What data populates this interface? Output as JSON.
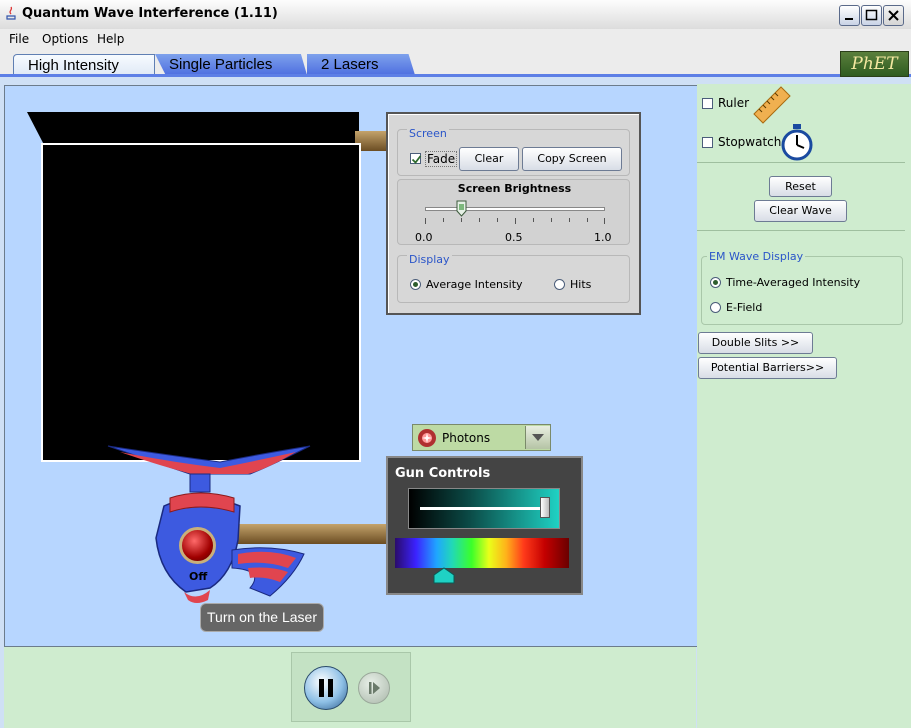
{
  "window": {
    "title": "Quantum Wave Interference (1.11)"
  },
  "menu": [
    "File",
    "Options",
    "Help"
  ],
  "tabs": [
    {
      "label": "High Intensity",
      "active": true
    },
    {
      "label": "Single Particles",
      "active": false
    },
    {
      "label": "2 Lasers",
      "active": false
    }
  ],
  "logo": "PhET",
  "screen_controls": {
    "screen_group": {
      "title": "Screen",
      "fade_label": "Fade",
      "fade_checked": true,
      "clear_label": "Clear",
      "copy_screen_label": "Copy Screen"
    },
    "brightness": {
      "title": "Screen Brightness",
      "ticks": [
        "0.0",
        "0.5",
        "1.0"
      ],
      "value": 0.2
    },
    "display_group": {
      "title": "Display",
      "options": [
        "Average Intensity",
        "Hits"
      ],
      "selected": "Average Intensity"
    }
  },
  "particle_select": {
    "value": "Photons"
  },
  "gun_controls": {
    "title": "Gun Controls",
    "intensity": 1.0
  },
  "gun": {
    "state_label": "Off",
    "turn_on_label": "Turn on the Laser"
  },
  "right_panel": {
    "ruler_label": "Ruler",
    "stopwatch_label": "Stopwatch",
    "reset_label": "Reset",
    "clear_wave_label": "Clear Wave",
    "em_wave_display": {
      "title": "EM Wave Display",
      "options": [
        "Time-Averaged Intensity",
        "E-Field"
      ],
      "selected": "Time-Averaged Intensity"
    },
    "double_slits_label": "Double Slits >>",
    "potential_barriers_label": "Potential Barriers>>"
  },
  "colors": {
    "play_area": "#b7d6ff",
    "panel": "#cfeccf",
    "tab_blue": "#5d7fe6"
  }
}
